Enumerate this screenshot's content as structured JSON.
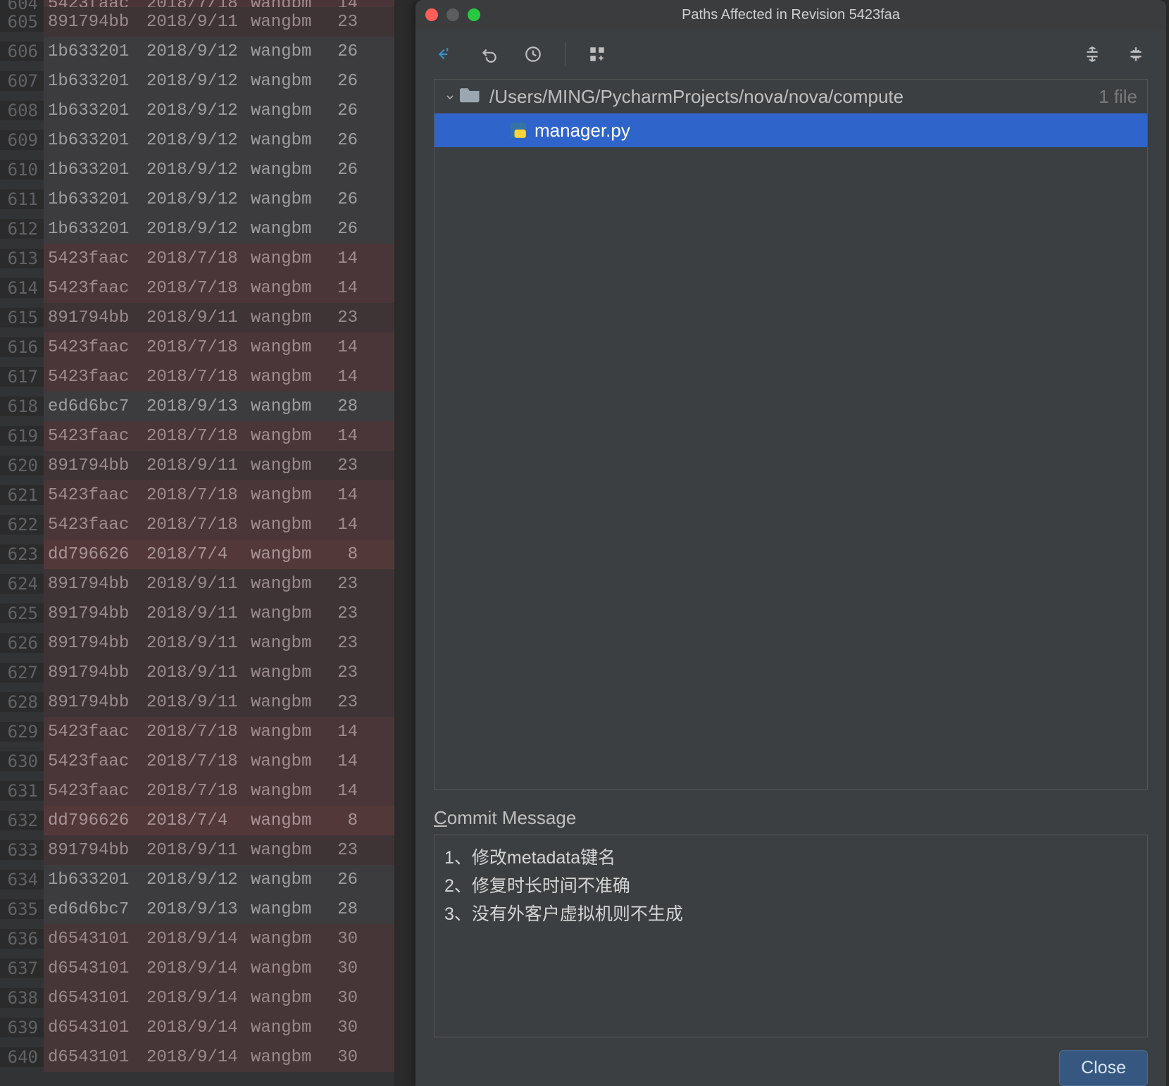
{
  "blame": {
    "rows": [
      {
        "line": 604,
        "hash": "5423faac",
        "date": "2018/7/18",
        "author": "wangbm",
        "rev": "14",
        "bg": "bg1",
        "partial": "top"
      },
      {
        "line": 605,
        "hash": "891794bb",
        "date": "2018/9/11",
        "author": "wangbm",
        "rev": "23",
        "bg": "bg2"
      },
      {
        "line": 606,
        "hash": "1b633201",
        "date": "2018/9/12",
        "author": "wangbm",
        "rev": "26",
        "bg": "bg0"
      },
      {
        "line": 607,
        "hash": "1b633201",
        "date": "2018/9/12",
        "author": "wangbm",
        "rev": "26",
        "bg": "bg0"
      },
      {
        "line": 608,
        "hash": "1b633201",
        "date": "2018/9/12",
        "author": "wangbm",
        "rev": "26",
        "bg": "bg0"
      },
      {
        "line": 609,
        "hash": "1b633201",
        "date": "2018/9/12",
        "author": "wangbm",
        "rev": "26",
        "bg": "bg0"
      },
      {
        "line": 610,
        "hash": "1b633201",
        "date": "2018/9/12",
        "author": "wangbm",
        "rev": "26",
        "bg": "bg0"
      },
      {
        "line": 611,
        "hash": "1b633201",
        "date": "2018/9/12",
        "author": "wangbm",
        "rev": "26",
        "bg": "bg0"
      },
      {
        "line": 612,
        "hash": "1b633201",
        "date": "2018/9/12",
        "author": "wangbm",
        "rev": "26",
        "bg": "bg0"
      },
      {
        "line": 613,
        "hash": "5423faac",
        "date": "2018/7/18",
        "author": "wangbm",
        "rev": "14",
        "bg": "bg1"
      },
      {
        "line": 614,
        "hash": "5423faac",
        "date": "2018/7/18",
        "author": "wangbm",
        "rev": "14",
        "bg": "bg1"
      },
      {
        "line": 615,
        "hash": "891794bb",
        "date": "2018/9/11",
        "author": "wangbm",
        "rev": "23",
        "bg": "bg2"
      },
      {
        "line": 616,
        "hash": "5423faac",
        "date": "2018/7/18",
        "author": "wangbm",
        "rev": "14",
        "bg": "bg1"
      },
      {
        "line": 617,
        "hash": "5423faac",
        "date": "2018/7/18",
        "author": "wangbm",
        "rev": "14",
        "bg": "bg1"
      },
      {
        "line": 618,
        "hash": "ed6d6bc7",
        "date": "2018/9/13",
        "author": "wangbm",
        "rev": "28",
        "bg": "bg0"
      },
      {
        "line": 619,
        "hash": "5423faac",
        "date": "2018/7/18",
        "author": "wangbm",
        "rev": "14",
        "bg": "bg1"
      },
      {
        "line": 620,
        "hash": "891794bb",
        "date": "2018/9/11",
        "author": "wangbm",
        "rev": "23",
        "bg": "bg2"
      },
      {
        "line": 621,
        "hash": "5423faac",
        "date": "2018/7/18",
        "author": "wangbm",
        "rev": "14",
        "bg": "bg1"
      },
      {
        "line": 622,
        "hash": "5423faac",
        "date": "2018/7/18",
        "author": "wangbm",
        "rev": "14",
        "bg": "bg1"
      },
      {
        "line": 623,
        "hash": "dd796626",
        "date": "2018/7/4",
        "author": "wangbm",
        "rev": "8",
        "bg": "bg3"
      },
      {
        "line": 624,
        "hash": "891794bb",
        "date": "2018/9/11",
        "author": "wangbm",
        "rev": "23",
        "bg": "bg2"
      },
      {
        "line": 625,
        "hash": "891794bb",
        "date": "2018/9/11",
        "author": "wangbm",
        "rev": "23",
        "bg": "bg2"
      },
      {
        "line": 626,
        "hash": "891794bb",
        "date": "2018/9/11",
        "author": "wangbm",
        "rev": "23",
        "bg": "bg2"
      },
      {
        "line": 627,
        "hash": "891794bb",
        "date": "2018/9/11",
        "author": "wangbm",
        "rev": "23",
        "bg": "bg2"
      },
      {
        "line": 628,
        "hash": "891794bb",
        "date": "2018/9/11",
        "author": "wangbm",
        "rev": "23",
        "bg": "bg2"
      },
      {
        "line": 629,
        "hash": "5423faac",
        "date": "2018/7/18",
        "author": "wangbm",
        "rev": "14",
        "bg": "bg1"
      },
      {
        "line": 630,
        "hash": "5423faac",
        "date": "2018/7/18",
        "author": "wangbm",
        "rev": "14",
        "bg": "bg1"
      },
      {
        "line": 631,
        "hash": "5423faac",
        "date": "2018/7/18",
        "author": "wangbm",
        "rev": "14",
        "bg": "bg1"
      },
      {
        "line": 632,
        "hash": "dd796626",
        "date": "2018/7/4",
        "author": "wangbm",
        "rev": "8",
        "bg": "bg3"
      },
      {
        "line": 633,
        "hash": "891794bb",
        "date": "2018/9/11",
        "author": "wangbm",
        "rev": "23",
        "bg": "bg2"
      },
      {
        "line": 634,
        "hash": "1b633201",
        "date": "2018/9/12",
        "author": "wangbm",
        "rev": "26",
        "bg": "bg0"
      },
      {
        "line": 635,
        "hash": "ed6d6bc7",
        "date": "2018/9/13",
        "author": "wangbm",
        "rev": "28",
        "bg": "bg0"
      },
      {
        "line": 636,
        "hash": "d6543101",
        "date": "2018/9/14",
        "author": "wangbm",
        "rev": "30",
        "bg": "bg4"
      },
      {
        "line": 637,
        "hash": "d6543101",
        "date": "2018/9/14",
        "author": "wangbm",
        "rev": "30",
        "bg": "bg4"
      },
      {
        "line": 638,
        "hash": "d6543101",
        "date": "2018/9/14",
        "author": "wangbm",
        "rev": "30",
        "bg": "bg4"
      },
      {
        "line": 639,
        "hash": "d6543101",
        "date": "2018/9/14",
        "author": "wangbm",
        "rev": "30",
        "bg": "bg4"
      },
      {
        "line": 640,
        "hash": "d6543101",
        "date": "2018/9/14",
        "author": "wangbm",
        "rev": "30",
        "bg": "bg4"
      }
    ]
  },
  "dialog": {
    "title": "Paths Affected in Revision 5423faa",
    "tree": {
      "folder_path": "/Users/MING/PycharmProjects/nova/nova/compute",
      "file_count_label": "1 file",
      "file": "manager.py"
    },
    "commit_label_prefix": "C",
    "commit_label_rest": "ommit Message",
    "commit_lines": [
      "1、修改metadata键名",
      "2、修复时长时间不准确",
      "3、没有外客户虚拟机则不生成"
    ],
    "close_label": "Close"
  }
}
